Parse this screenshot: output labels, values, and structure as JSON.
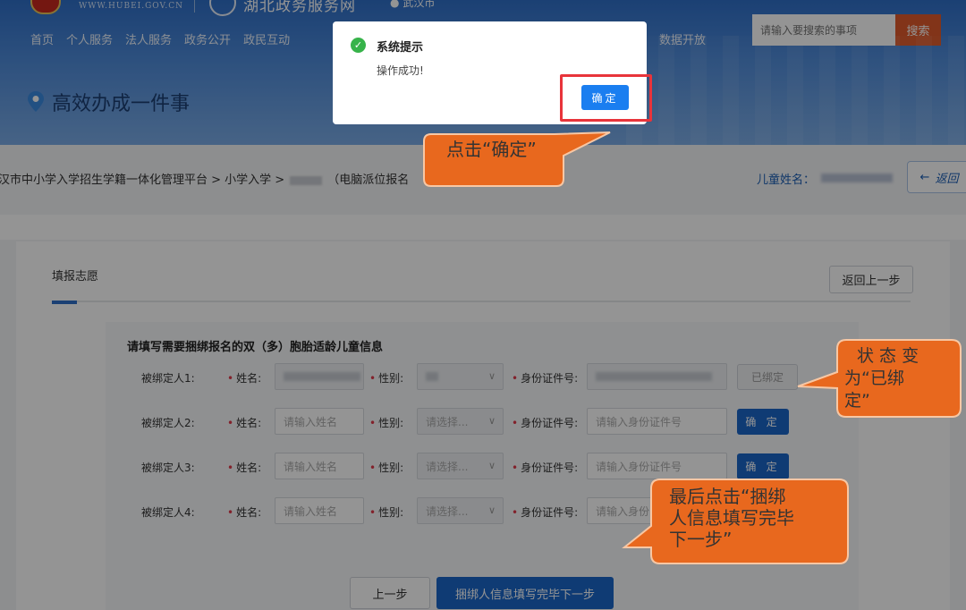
{
  "header": {
    "site_url": "WWW.HUBEI.GOV.CN",
    "site_name": "湖北政务服务网",
    "location": "武汉市",
    "nav": [
      "首页",
      "个人服务",
      "法人服务",
      "政务公开",
      "政民互动"
    ],
    "nav_extra": "数据开放",
    "search": {
      "placeholder": "请输入要搜索的事项",
      "button": "搜索"
    },
    "page_title": "高效办成一件事"
  },
  "breadcrumb": {
    "text_1": "汉市中小学入学招生学籍一体化管理平台 > 小学入学 >",
    "text_2": "（电脑派位报名",
    "child_label": "儿童姓名：",
    "back_label": "返回"
  },
  "main": {
    "tab_title": "填报志愿",
    "back_step": "返回上一步",
    "form_heading": "请填写需要捆绑报名的双（多）胞胎适龄儿童信息",
    "labels": {
      "name": "姓名:",
      "gender": "性别:",
      "id": "身份证件号:"
    },
    "rows": [
      {
        "who": "被绑定人1:",
        "name_placeholder": "",
        "gender": "",
        "id_placeholder": "",
        "action": "已绑定"
      },
      {
        "who": "被绑定人2:",
        "name_placeholder": "请输入姓名",
        "gender": "请选择...",
        "id_placeholder": "请输入身份证件号",
        "action": "确 定"
      },
      {
        "who": "被绑定人3:",
        "name_placeholder": "请输入姓名",
        "gender": "请选择...",
        "id_placeholder": "请输入身份证件号",
        "action": "确 定"
      },
      {
        "who": "被绑定人4:",
        "name_placeholder": "请输入姓名",
        "gender": "请选择...",
        "id_placeholder": "请输入身份",
        "action": ""
      }
    ],
    "prev_button": "上一步",
    "next_button": "捆绑人信息填写完毕下一步"
  },
  "dialog": {
    "title": "系统提示",
    "message": "操作成功!",
    "ok": "确定"
  },
  "annotations": {
    "a1": "点击“确定”",
    "a2_l1": "状 态 变",
    "a2_l2": "为“已绑",
    "a2_l3": "定”",
    "a3_l1": "最后点击“捆绑",
    "a3_l2": "人信息填写完毕",
    "a3_l3": "下一步”"
  },
  "colors": {
    "primary": "#1a66c9",
    "annotation": "#e86a20",
    "highlight": "#e8343b",
    "success": "#37b34a"
  }
}
